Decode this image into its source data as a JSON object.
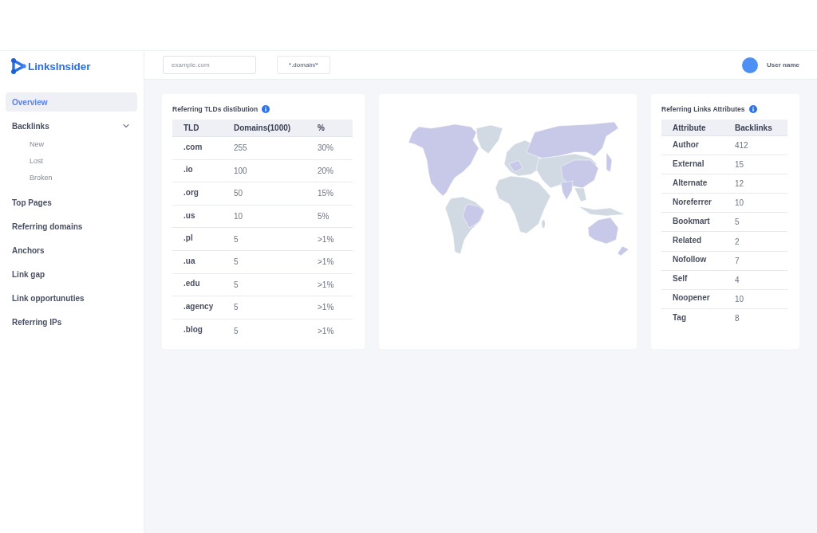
{
  "brand": {
    "name": "LinksInsider"
  },
  "header": {
    "search_field": {
      "placeholder": "example.com"
    },
    "pattern_field": {
      "value": "*.domain/*"
    },
    "user": {
      "name": "User name"
    }
  },
  "sidebar": {
    "items": [
      {
        "label": "Overview",
        "selected": true
      },
      {
        "label": "Backlinks",
        "selected": false,
        "expanded": true,
        "children": [
          {
            "label": "New",
            "selected": false
          },
          {
            "label": "Lost",
            "selected": false
          },
          {
            "label": "Broken",
            "selected": false
          }
        ]
      },
      {
        "label": "Top Pages",
        "selected": false
      },
      {
        "label": "Referring domains",
        "selected": false
      },
      {
        "label": "Anchors",
        "selected": false
      },
      {
        "label": "Link gap",
        "selected": false
      },
      {
        "label": "Link opportunuties",
        "selected": false
      },
      {
        "label": "Referring IPs",
        "selected": false
      }
    ]
  },
  "tlds_card": {
    "title": "Referring TLDs distibution",
    "columns": [
      "TLD",
      "Domains(1000)",
      "%"
    ],
    "rows": [
      [
        ".com",
        "255",
        "30%"
      ],
      [
        ".io",
        "100",
        "20%"
      ],
      [
        ".org",
        "50",
        "15%"
      ],
      [
        ".us",
        "10",
        "5%"
      ],
      [
        ".pl",
        "5",
        ">1%"
      ],
      [
        ".ua",
        "5",
        ">1%"
      ],
      [
        ".edu",
        "5",
        ">1%"
      ],
      [
        ".agency",
        "5",
        ">1%"
      ],
      [
        ".blog",
        "5",
        ">1%"
      ]
    ]
  },
  "attributes_card": {
    "title": "Referring Links Attributes",
    "columns": [
      "Attribute",
      "Backlinks"
    ],
    "rows": [
      [
        "Author",
        "412"
      ],
      [
        "External",
        "15"
      ],
      [
        "Alternate",
        "12"
      ],
      [
        "Noreferrer",
        "10"
      ],
      [
        "Bookmart",
        "5"
      ],
      [
        "Related",
        "2"
      ],
      [
        "Nofollow",
        "7"
      ],
      [
        "Self",
        "4"
      ],
      [
        "Noopener",
        "10"
      ],
      [
        "Tag",
        "8"
      ]
    ]
  }
}
